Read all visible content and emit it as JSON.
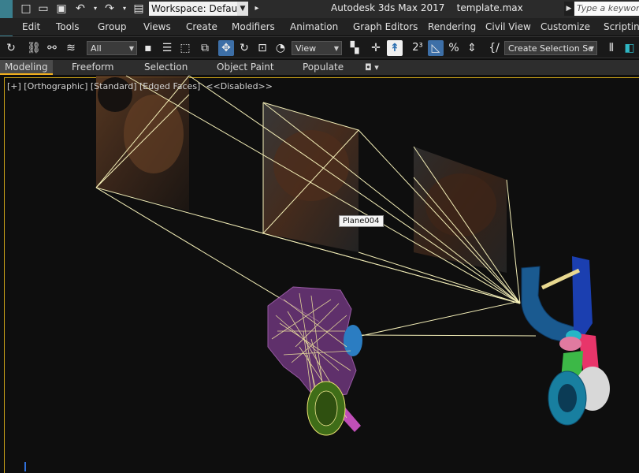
{
  "title_bar": {
    "workspace": "Workspace: Default",
    "app_title": "Autodesk 3ds Max 2017",
    "file_name": "template.max",
    "search_placeholder": "Type a keyword"
  },
  "menu": [
    "Edit",
    "Tools",
    "Group",
    "Views",
    "Create",
    "Modifiers",
    "Animation",
    "Graph Editors",
    "Rendering",
    "Civil View",
    "Customize",
    "Scripting"
  ],
  "toolbar": {
    "filter_select": "All",
    "reference_coord": "View",
    "snap_label": "2³",
    "selection_set": "Create Selection Se"
  },
  "ribbon_tabs": [
    "Modeling",
    "Freeform",
    "Selection",
    "Object Paint",
    "Populate"
  ],
  "viewport": {
    "label": "[+] [Orthographic] [Standard] [Edged Faces]  <<Disabled>>",
    "hover_label": "Plane004"
  },
  "colors": {
    "accent_blue": "#3d6fa7",
    "frame_gold": "#c8a018",
    "tab_underline": "#f2b01e"
  }
}
